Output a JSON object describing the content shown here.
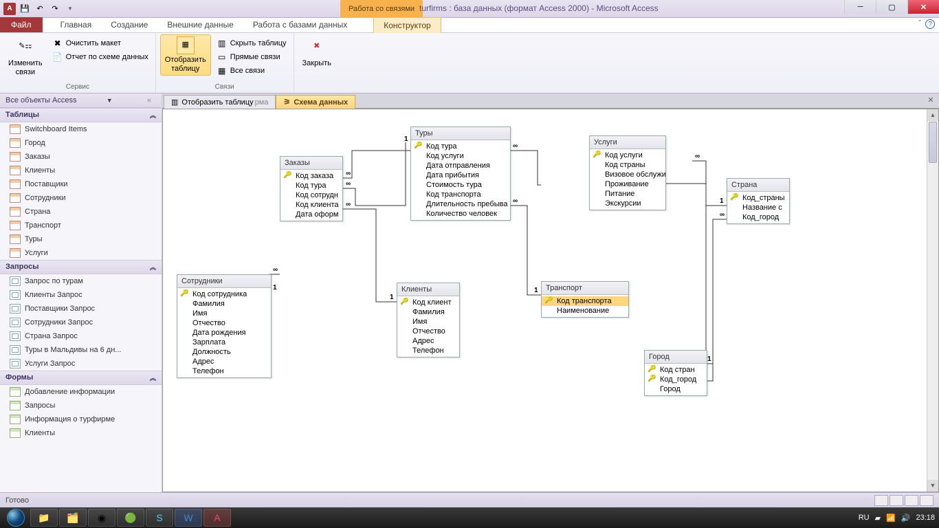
{
  "window": {
    "contextual_title": "Работа со связями",
    "title": "turfirms : база данных (формат Access 2000)  -  Microsoft Access",
    "app_letter": "A"
  },
  "ribbon_tabs": {
    "file": "Файл",
    "home": "Главная",
    "create": "Создание",
    "external": "Внешние данные",
    "dbtools": "Работа с базами данных",
    "design": "Конструктор"
  },
  "ribbon": {
    "g1": {
      "edit_rel": "Изменить\nсвязи",
      "clear_layout": "Очистить макет",
      "rel_report": "Отчет по схеме данных",
      "label": "Сервис"
    },
    "g2": {
      "show_table": "Отобразить\nтаблицу",
      "hide_table": "Скрыть таблицу",
      "direct_rel": "Прямые связи",
      "all_rel": "Все связи",
      "label": "Связи"
    },
    "g3": {
      "close": "Закрыть"
    }
  },
  "nav": {
    "header": "Все объекты Access",
    "groups": {
      "tables": {
        "label": "Таблицы",
        "items": [
          "Switchboard Items",
          "Город",
          "Заказы",
          "Клиенты",
          "Поставщики",
          "Сотрудники",
          "Страна",
          "Транспорт",
          "Туры",
          "Услуги"
        ]
      },
      "queries": {
        "label": "Запросы",
        "items": [
          "Запрос по турам",
          "Клиенты Запрос",
          "Поставщики Запрос",
          "Сотрудники Запрос",
          "Страна Запрос",
          "Туры в Мальдивы на 6 дн...",
          "Услуги Запрос"
        ]
      },
      "forms": {
        "label": "Формы",
        "items": [
          "Добавление информации",
          "Запросы",
          "Информация о турфирме",
          "Клиенты"
        ]
      }
    }
  },
  "doc_tabs": {
    "t1": "Отобразить таблицу",
    "t1_suffix": "рма",
    "t2": "Схема данных"
  },
  "tables": {
    "tours": {
      "title": "Туры",
      "fields": [
        "Код тура",
        "Код услуги",
        "Дата отправления",
        "Дата прибытия",
        "Стоимость тура",
        "Код транспорта",
        "Длительность пребыва",
        "Количество человек"
      ],
      "keys": [
        0
      ]
    },
    "orders": {
      "title": "Заказы",
      "fields": [
        "Код заказа",
        "Код тура",
        "Код сотрудн",
        "Код клиента",
        "Дата оформ"
      ],
      "keys": [
        0
      ]
    },
    "services": {
      "title": "Услуги",
      "fields": [
        "Код услуги",
        "Код страны",
        "Визовое обслужи",
        "Проживание",
        "Питание",
        "Экскурсии"
      ],
      "keys": [
        0
      ]
    },
    "country": {
      "title": "Страна",
      "fields": [
        "Код_страны",
        "Название с",
        "Код_город"
      ],
      "keys": [
        0
      ]
    },
    "employees": {
      "title": "Сотрудники",
      "fields": [
        "Код сотрудника",
        "Фамилия",
        "Имя",
        "Отчество",
        "Дата рождения",
        "Зарплата",
        "Должность",
        "Адрес",
        "Телефон"
      ],
      "keys": [
        0
      ]
    },
    "clients": {
      "title": "Клиенты",
      "fields": [
        "Код клиент",
        "Фамилия",
        "Имя",
        "Отчество",
        "Адрес",
        "Телефон"
      ],
      "keys": [
        0
      ]
    },
    "transport": {
      "title": "Транспорт",
      "fields": [
        "Код транспорта",
        "Наименование"
      ],
      "keys": [
        0
      ],
      "selected": [
        0
      ]
    },
    "city": {
      "title": "Город",
      "fields": [
        "Код стран",
        "Код_город",
        "Город"
      ],
      "keys": [
        0,
        1
      ]
    }
  },
  "rel_labels": {
    "one": "1",
    "many": "∞"
  },
  "status": {
    "ready": "Готово",
    "lang": "RU"
  },
  "taskbar": {
    "time": "23:18"
  }
}
